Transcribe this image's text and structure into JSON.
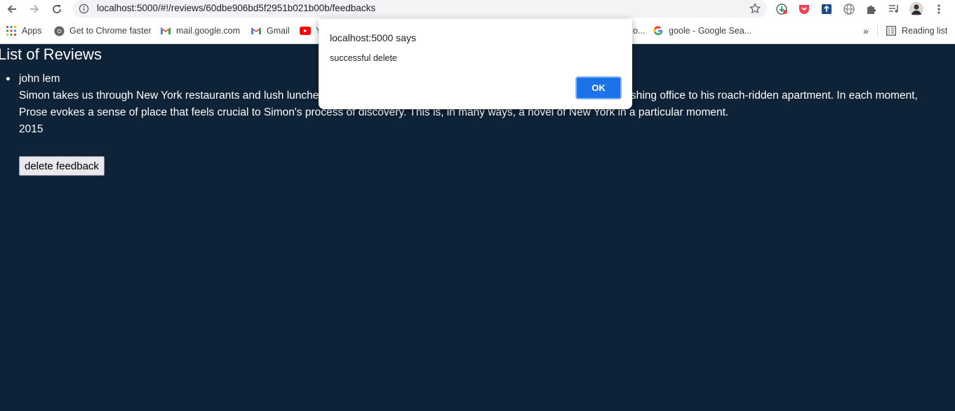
{
  "browser": {
    "url": "localhost:5000/#!/reviews/60dbe906bd5f2951b021b00b/feedbacks",
    "icons": [
      "back-arrow-icon",
      "forward-arrow-icon",
      "reload-icon",
      "info-icon",
      "star-icon",
      "extension-icons",
      "puzzle-icon",
      "media-icon",
      "profile-avatar",
      "kebab-menu-icon"
    ]
  },
  "bookmarks": {
    "items": [
      {
        "label": "Apps",
        "icon": "apps-grid-icon"
      },
      {
        "label": "Get to Chrome faster",
        "icon": "chrome-icon"
      },
      {
        "label": "mail.google.com",
        "icon": "gmail-icon"
      },
      {
        "label": "Gmail",
        "icon": "gmail-icon"
      },
      {
        "label": "Y",
        "icon": "youtube-icon"
      },
      {
        "label": "o...",
        "icon": ""
      },
      {
        "label": "goole - Google Sea...",
        "icon": "google-icon"
      }
    ],
    "overflow": "»",
    "reading_list": "Reading list"
  },
  "page": {
    "title": "List of Reviews",
    "reviews": [
      {
        "author": "john lem",
        "text": "Simon takes us through New York restaurants and lush luncheons, the museums, a Brooklyn yoga class, from the swanky publishing office to his roach-ridden apartment. In each moment, Prose evokes a sense of place that feels crucial to Simon's process of discovery. This is, in many ways, a novel of New York in a particular moment.",
        "year": "2015",
        "delete_label": "delete feedback"
      }
    ]
  },
  "dialog": {
    "title": "localhost:5000 says",
    "message": "successful delete",
    "ok_label": "OK",
    "accent": "#1a73e8"
  },
  "colors": {
    "page_bg": "#0e2238",
    "text": "#ffffff"
  }
}
